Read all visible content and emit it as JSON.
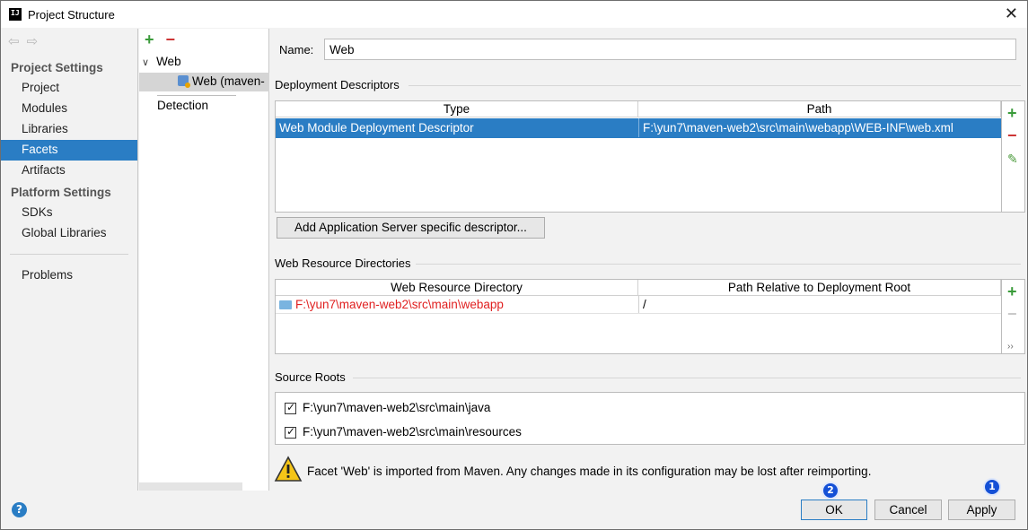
{
  "window": {
    "title": "Project Structure",
    "app_icon_text": "IJ",
    "close_glyph": "✕"
  },
  "nav": {
    "project_settings": "Project Settings",
    "project_items": [
      "Project",
      "Modules",
      "Libraries",
      "Facets",
      "Artifacts"
    ],
    "platform_settings": "Platform Settings",
    "platform_items": [
      "SDKs",
      "Global Libraries"
    ],
    "problems": "Problems",
    "selected": "Facets"
  },
  "tree": {
    "root": "Web",
    "child": "Web (maven-",
    "detection": "Detection"
  },
  "form": {
    "name_label": "Name:",
    "name_value": "Web"
  },
  "deployment": {
    "title": "Deployment Descriptors",
    "columns": [
      "Type",
      "Path"
    ],
    "rows": [
      {
        "type": "Web Module Deployment Descriptor",
        "path": "F:\\yun7\\maven-web2\\src\\main\\webapp\\WEB-INF\\web.xml"
      }
    ],
    "add_server_button": "Add Application Server specific descriptor..."
  },
  "web_resources": {
    "title": "Web Resource Directories",
    "columns": [
      "Web Resource Directory",
      "Path Relative to Deployment Root"
    ],
    "rows": [
      {
        "dir": "F:\\yun7\\maven-web2\\src\\main\\webapp",
        "relative": "/"
      }
    ],
    "more_glyph": "››"
  },
  "source_roots": {
    "title": "Source Roots",
    "items": [
      {
        "path": "F:\\yun7\\maven-web2\\src\\main\\java",
        "checked": true
      },
      {
        "path": "F:\\yun7\\maven-web2\\src\\main\\resources",
        "checked": true
      }
    ]
  },
  "warning": "Facet 'Web' is imported from Maven. Any changes made in its configuration may be lost after reimporting.",
  "buttons": {
    "ok": "OK",
    "cancel": "Cancel",
    "apply": "Apply",
    "help": "?"
  },
  "badges": {
    "ok_badge": "2",
    "apply_badge": "1"
  },
  "colors": {
    "selection": "#2a7dc4",
    "add": "#3a9b3a",
    "remove": "#cc3333",
    "path_error": "#e02020",
    "badge": "#1450d6"
  }
}
